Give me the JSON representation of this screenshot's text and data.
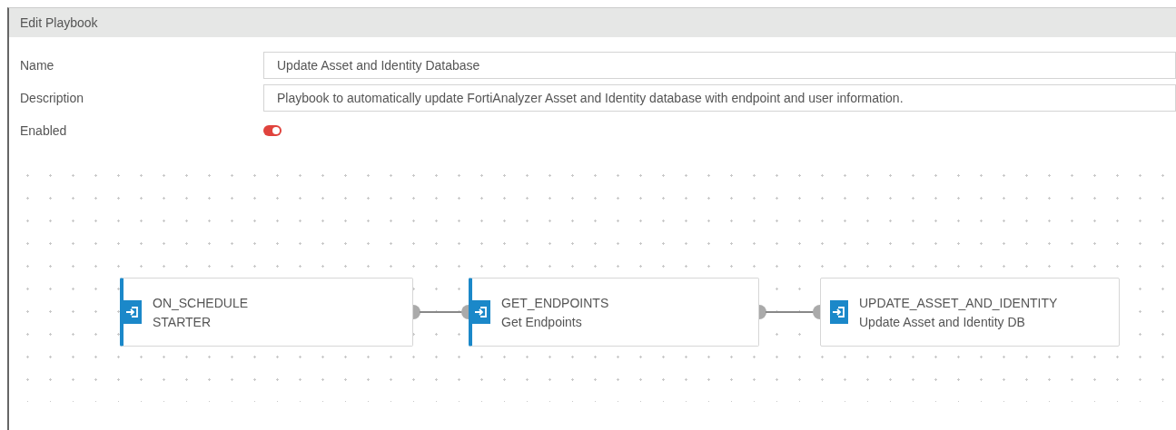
{
  "window": {
    "title": "Edit Playbook"
  },
  "fields": [
    {
      "label": "Name",
      "value": "Update Asset and Identity Database"
    },
    {
      "label": "Description",
      "value": "Playbook to automatically update FortiAnalyzer Asset and Identity database with endpoint and user information."
    }
  ],
  "enabled": {
    "label": "Enabled",
    "on": true
  },
  "nodes": [
    {
      "kind": "standard",
      "title": "ON_SCHEDULE",
      "subtitle": "STARTER"
    },
    {
      "kind": "standard",
      "title": "GET_ENDPOINTS",
      "subtitle": "Get Endpoints"
    },
    {
      "kind": "compact",
      "title": "UPDATE_ASSET_AND_IDENTITY",
      "subtitle": "Update Asset and Identity DB"
    }
  ]
}
